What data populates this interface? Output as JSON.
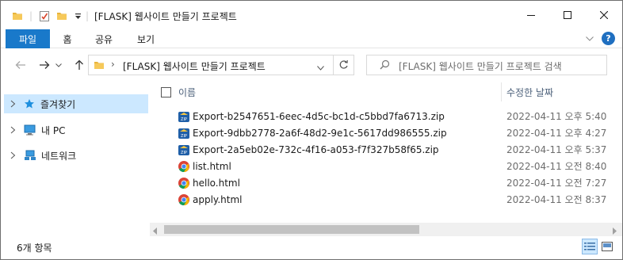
{
  "window": {
    "title": "[FLASK] 웹사이트 만들기 프로젝트",
    "minimize_glyph": "—",
    "maximize_glyph": "☐",
    "close_glyph": "✕"
  },
  "ribbon": {
    "tabs": [
      {
        "label": "파일"
      },
      {
        "label": "홈"
      },
      {
        "label": "공유"
      },
      {
        "label": "보기"
      }
    ],
    "expand_glyph": "∨",
    "help_glyph": "?"
  },
  "address": {
    "breadcrumb": "[FLASK] 웹사이트 만들기 프로젝트",
    "separator": "›",
    "search_placeholder": "[FLASK] 웹사이트 만들기 프로젝트 검색"
  },
  "sidebar": {
    "items": [
      {
        "label": "즐겨찾기",
        "icon": "star-icon"
      },
      {
        "label": "내 PC",
        "icon": "pc-icon"
      },
      {
        "label": "네트워크",
        "icon": "network-icon"
      }
    ]
  },
  "list": {
    "headers": {
      "name": "이름",
      "date": "수정한 날짜"
    },
    "files": [
      {
        "name": "Export-b2547651-6eec-4d5c-bc1d-c5bbd7fa6713.zip",
        "date": "2022-04-11 오후 5:40",
        "icon": "zip-icon"
      },
      {
        "name": "Export-9dbb2778-2a6f-48d2-9e1c-5617dd986555.zip",
        "date": "2022-04-11 오후 4:27",
        "icon": "zip-icon"
      },
      {
        "name": "Export-2a5eb02e-732c-4f16-a053-f7f327b58f65.zip",
        "date": "2022-04-11 오후 5:37",
        "icon": "zip-icon"
      },
      {
        "name": "list.html",
        "date": "2022-04-11 오전 8:40",
        "icon": "chrome-icon"
      },
      {
        "name": "hello.html",
        "date": "2022-04-11 오전 7:27",
        "icon": "chrome-icon"
      },
      {
        "name": "apply.html",
        "date": "2022-04-11 오전 8:37",
        "icon": "chrome-icon"
      }
    ]
  },
  "status": {
    "item_count": "6개 항목"
  },
  "colors": {
    "accent": "#1979ca",
    "selection": "#cce8ff",
    "folder": "#e8b43c",
    "help": "#1f6fc0"
  }
}
